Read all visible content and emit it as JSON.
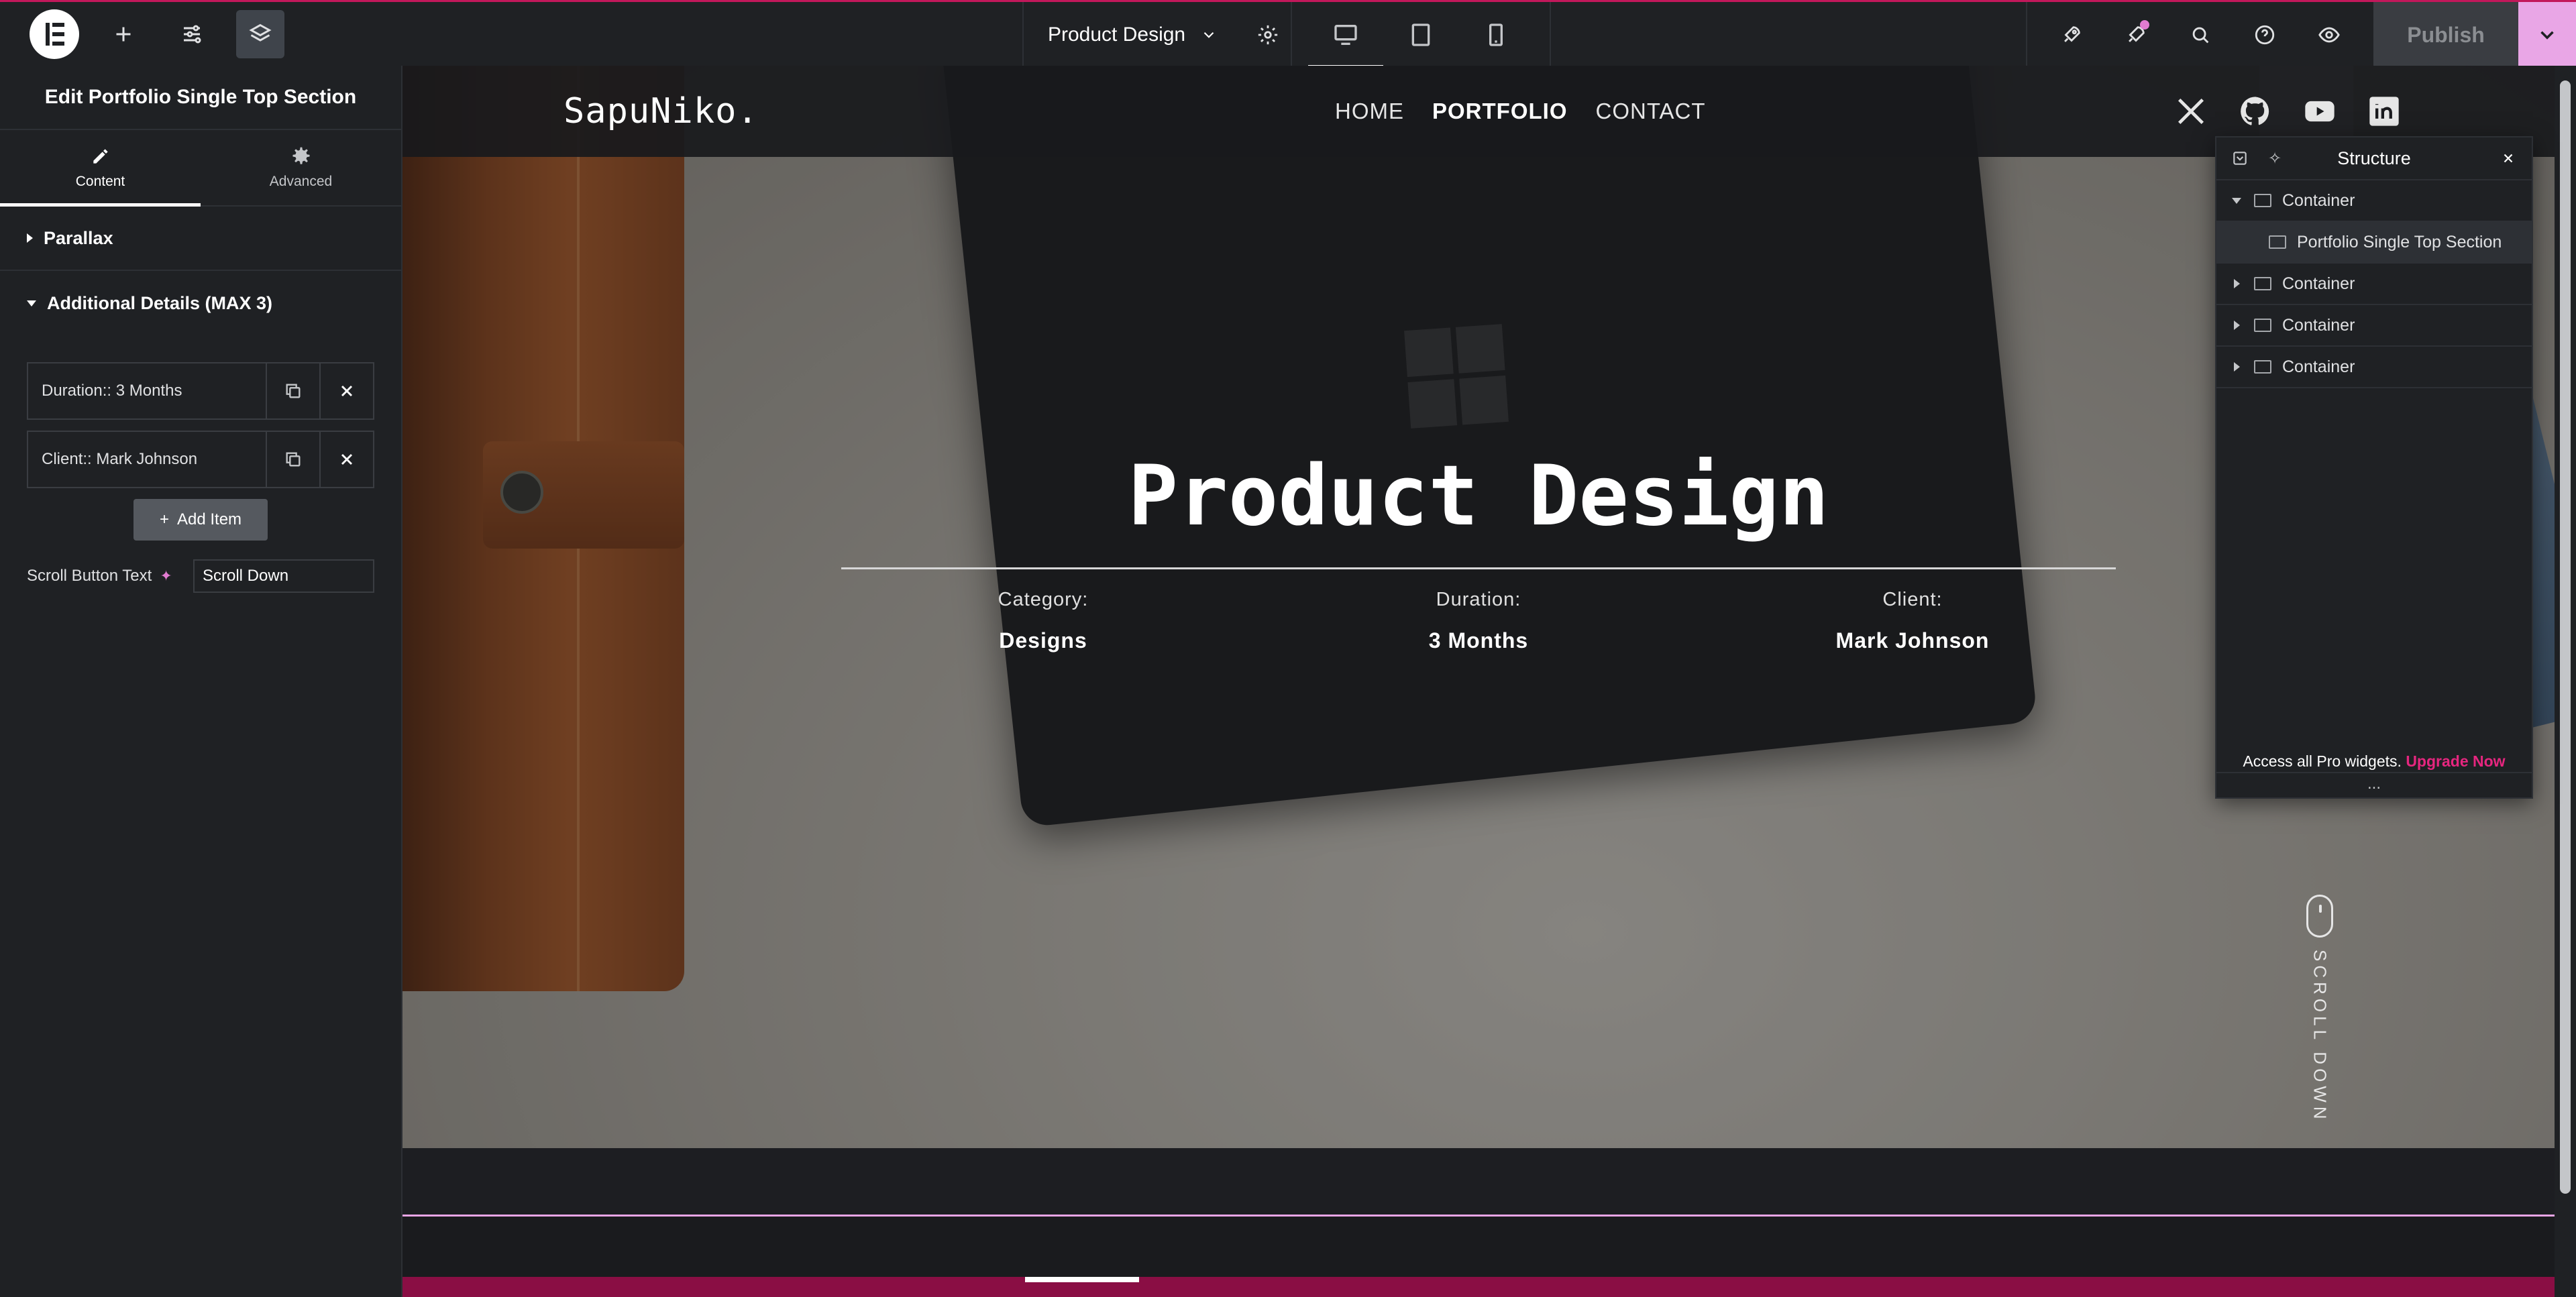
{
  "topbar": {
    "doc_title": "Product Design",
    "publish_label": "Publish",
    "left_icons": [
      "elementor-logo-icon",
      "plus-icon",
      "sliders-icon",
      "layers-icon"
    ],
    "devices": [
      "desktop-icon",
      "tablet-icon",
      "mobile-icon"
    ],
    "right_icons": [
      "rocket-icon",
      "notifications-icon",
      "search-icon",
      "help-icon",
      "preview-eye-icon"
    ]
  },
  "panel": {
    "title": "Edit Portfolio Single Top Section",
    "tabs": [
      {
        "label": "Content",
        "icon": "pencil-icon"
      },
      {
        "label": "Advanced",
        "icon": "gear-icon"
      }
    ],
    "sections": {
      "parallax": "Parallax",
      "additional": "Additional Details (MAX 3)"
    },
    "items": [
      {
        "label": "Duration:: 3 Months"
      },
      {
        "label": "Client:: Mark Johnson"
      }
    ],
    "add_item": "Add Item",
    "scroll_label": "Scroll Button Text",
    "scroll_value": "Scroll Down"
  },
  "site": {
    "brand": "SapuNiko.",
    "menu": [
      "HOME",
      "PORTFOLIO",
      "CONTACT"
    ],
    "socials": [
      "x-icon",
      "github-icon",
      "youtube-icon",
      "linkedin-icon"
    ],
    "hero_title": "Product Design",
    "meta": [
      {
        "key": "Category:",
        "value": "Designs"
      },
      {
        "key": "Duration:",
        "value": "3 Months"
      },
      {
        "key": "Client:",
        "value": "Mark Johnson"
      }
    ],
    "scroll_text": "SCROLL DOWN"
  },
  "structure": {
    "title": "Structure",
    "rows": [
      {
        "label": "Container"
      },
      {
        "label": "Portfolio Single Top Section"
      },
      {
        "label": "Container"
      },
      {
        "label": "Container"
      },
      {
        "label": "Container"
      }
    ],
    "promo": "Access all Pro widgets.",
    "upgrade": "Upgrade Now",
    "dots": "..."
  },
  "colors": {
    "accent_pink": "#e6267f",
    "publish_more": "#e9a6e6",
    "dark_bg": "#1f2124"
  }
}
